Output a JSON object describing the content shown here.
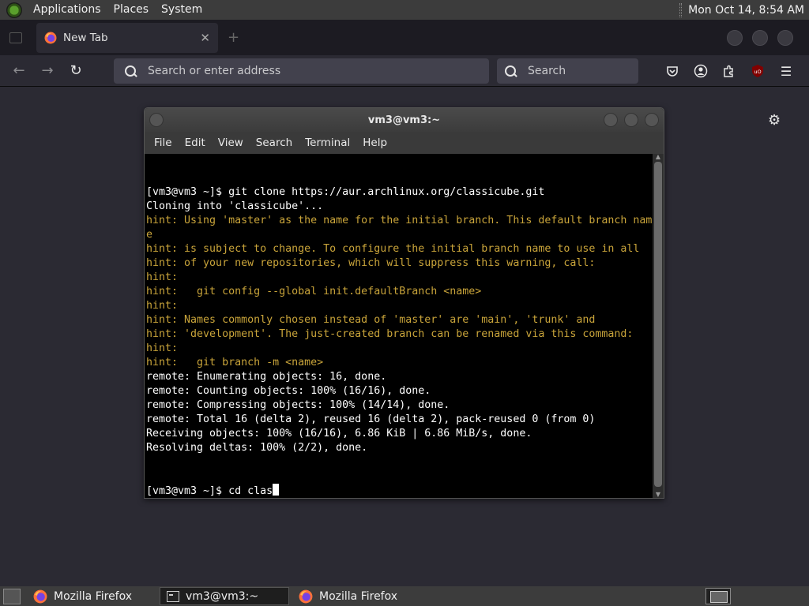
{
  "top_panel": {
    "menus": [
      "Applications",
      "Places",
      "System"
    ],
    "clock": "Mon Oct 14,  8:54 AM"
  },
  "firefox": {
    "tab": {
      "label": "New Tab"
    },
    "urlbar_placeholder": "Search or enter address",
    "searchbar_placeholder": "Search",
    "extension_badge": "uO"
  },
  "terminal": {
    "title": "vm3@vm3:~",
    "menus": [
      "File",
      "Edit",
      "View",
      "Search",
      "Terminal",
      "Help"
    ],
    "lines": [
      {
        "text": "[vm3@vm3 ~]$ git clone https://aur.archlinux.org/classicube.git",
        "hint": false
      },
      {
        "text": "Cloning into 'classicube'...",
        "hint": false
      },
      {
        "text": "hint: Using 'master' as the name for the initial branch. This default branch nam",
        "hint": true
      },
      {
        "text": "e",
        "hint": true
      },
      {
        "text": "hint: is subject to change. To configure the initial branch name to use in all",
        "hint": true
      },
      {
        "text": "hint: of your new repositories, which will suppress this warning, call:",
        "hint": true
      },
      {
        "text": "hint:",
        "hint": true
      },
      {
        "text": "hint:   git config --global init.defaultBranch <name>",
        "hint": true
      },
      {
        "text": "hint:",
        "hint": true
      },
      {
        "text": "hint: Names commonly chosen instead of 'master' are 'main', 'trunk' and",
        "hint": true
      },
      {
        "text": "hint: 'development'. The just-created branch can be renamed via this command:",
        "hint": true
      },
      {
        "text": "hint:",
        "hint": true
      },
      {
        "text": "hint:   git branch -m <name>",
        "hint": true
      },
      {
        "text": "remote: Enumerating objects: 16, done.",
        "hint": false
      },
      {
        "text": "remote: Counting objects: 100% (16/16), done.",
        "hint": false
      },
      {
        "text": "remote: Compressing objects: 100% (14/14), done.",
        "hint": false
      },
      {
        "text": "remote: Total 16 (delta 2), reused 16 (delta 2), pack-reused 0 (from 0)",
        "hint": false
      },
      {
        "text": "Receiving objects: 100% (16/16), 6.86 KiB | 6.86 MiB/s, done.",
        "hint": false
      },
      {
        "text": "Resolving deltas: 100% (2/2), done.",
        "hint": false
      }
    ],
    "prompt": "[vm3@vm3 ~]$ cd clas"
  },
  "taskbar": {
    "tasks": [
      {
        "label": "Mozilla Firefox",
        "icon": "firefox-icon",
        "active": false
      },
      {
        "label": "vm3@vm3:~",
        "icon": "terminal-icon",
        "active": true
      },
      {
        "label": "Mozilla Firefox",
        "icon": "firefox-icon",
        "active": false
      }
    ]
  }
}
